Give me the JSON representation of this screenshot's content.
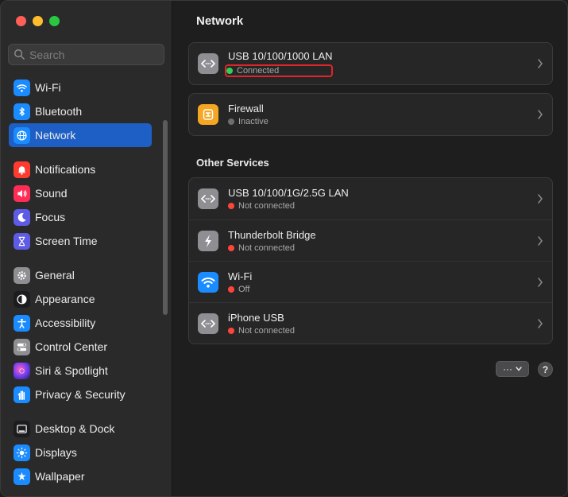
{
  "search": {
    "placeholder": "Search"
  },
  "sidebar": {
    "items": [
      {
        "label": "Wi-Fi",
        "icon": "wifi-icon",
        "color": "#1a8cff"
      },
      {
        "label": "Bluetooth",
        "icon": "bluetooth-icon",
        "color": "#1a8cff"
      },
      {
        "label": "Network",
        "icon": "globe-icon",
        "color": "#1a8cff",
        "active": true
      },
      {
        "label": "Notifications",
        "icon": "bell-icon",
        "color": "#ff3b30"
      },
      {
        "label": "Sound",
        "icon": "speaker-icon",
        "color": "#ff2d55"
      },
      {
        "label": "Focus",
        "icon": "moon-icon",
        "color": "#5e5ce6"
      },
      {
        "label": "Screen Time",
        "icon": "hourglass-icon",
        "color": "#5e5ce6"
      },
      {
        "label": "General",
        "icon": "gear-icon",
        "color": "#8e8e93"
      },
      {
        "label": "Appearance",
        "icon": "appearance-icon",
        "color": "#1c1c1e"
      },
      {
        "label": "Accessibility",
        "icon": "accessibility-icon",
        "color": "#1a8cff"
      },
      {
        "label": "Control Center",
        "icon": "toggles-icon",
        "color": "#8e8e93"
      },
      {
        "label": "Siri & Spotlight",
        "icon": "siri-icon",
        "color": "#a04cd8"
      },
      {
        "label": "Privacy & Security",
        "icon": "hand-icon",
        "color": "#1a8cff"
      },
      {
        "label": "Desktop & Dock",
        "icon": "dock-icon",
        "color": "#1c1c1e"
      },
      {
        "label": "Displays",
        "icon": "sun-icon",
        "color": "#1a8cff"
      },
      {
        "label": "Wallpaper",
        "icon": "wallpaper-icon",
        "color": "#1a8cff"
      }
    ]
  },
  "main": {
    "title": "Network",
    "primary": [
      {
        "name": "USB 10/100/1000 LAN",
        "status": "Connected",
        "status_color": "#30d158",
        "icon": "ethernet-icon"
      },
      {
        "name": "Firewall",
        "status": "Inactive",
        "status_color": "#6e6e70",
        "icon": "firewall-icon"
      }
    ],
    "other_title": "Other Services",
    "other": [
      {
        "name": "USB 10/100/1G/2.5G LAN",
        "status": "Not connected",
        "status_color": "#ff453a",
        "icon": "ethernet-icon"
      },
      {
        "name": "Thunderbolt Bridge",
        "status": "Not connected",
        "status_color": "#ff453a",
        "icon": "thunderbolt-icon"
      },
      {
        "name": "Wi-Fi",
        "status": "Off",
        "status_color": "#ff453a",
        "icon": "wifi-icon"
      },
      {
        "name": "iPhone USB",
        "status": "Not connected",
        "status_color": "#ff453a",
        "icon": "ethernet-icon"
      }
    ],
    "more_button": "···",
    "help_button": "?"
  }
}
